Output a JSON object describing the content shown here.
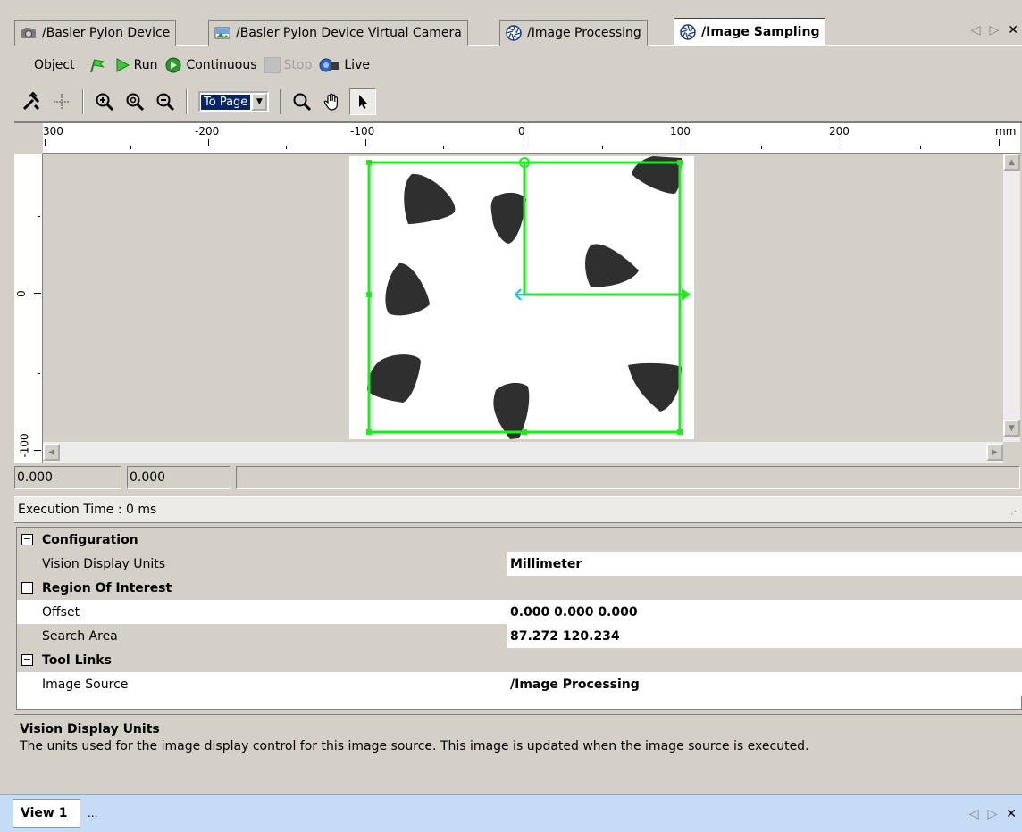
{
  "tabs": [
    {
      "label": "/Basler Pylon Device",
      "icon": "camera-icon",
      "active": false
    },
    {
      "label": "/Basler Pylon Device Virtual Camera",
      "icon": "picture-icon",
      "active": false
    },
    {
      "label": "/Image Processing",
      "icon": "aperture-icon",
      "active": false
    },
    {
      "label": "/Image Sampling",
      "icon": "aperture-icon",
      "active": true
    }
  ],
  "toolbar1": {
    "object_label": "Object",
    "run_label": "Run",
    "continuous_label": "Continuous",
    "stop_label": "Stop",
    "live_label": "Live"
  },
  "toolbar2": {
    "zoom_value": "To Page"
  },
  "ruler": {
    "h_labels": [
      "300",
      "-200",
      "-100",
      "0",
      "100",
      "200",
      "mm"
    ],
    "v_labels": [
      "0",
      "-100"
    ]
  },
  "coords": {
    "x": "0.000",
    "y": "0.000"
  },
  "status": {
    "execution_time": "Execution Time : 0 ms"
  },
  "properties": {
    "configuration": {
      "title": "Configuration",
      "vision_display_units_label": "Vision Display Units",
      "vision_display_units_value": "Millimeter"
    },
    "roi": {
      "title": "Region Of Interest",
      "offset_label": "Offset",
      "offset_value": "0.000 0.000 0.000",
      "search_area_label": "Search Area",
      "search_area_value": "87.272 120.234"
    },
    "tool_links": {
      "title": "Tool Links",
      "image_source_label": "Image Source",
      "image_source_value": "/Image Processing"
    }
  },
  "description": {
    "title": "Vision Display Units",
    "text": "The units used for the image display control for this image source. This image is updated when the image source is executed."
  },
  "view_tabs": {
    "active": "View 1",
    "more": "..."
  },
  "colors": {
    "roi_green": "#19f019",
    "origin_cyan": "#00c8ff",
    "selection_blue": "#0a246a"
  }
}
